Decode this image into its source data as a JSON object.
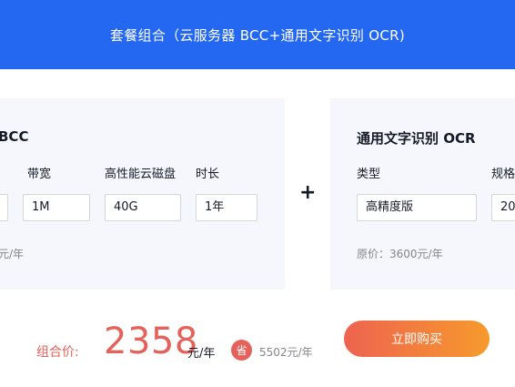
{
  "header": {
    "title": "套餐组合（云服务器 BCC+通用文字识别 OCR)"
  },
  "bcc_card": {
    "title": "BCC",
    "bandwidth_label": "带宽",
    "bandwidth_value": "1M",
    "disk_label": "高性能云磁盘",
    "disk_value": "40G",
    "duration_label": "时长",
    "duration_value": "1年",
    "original_price_partial": "元/年"
  },
  "plus_sign": "+",
  "ocr_card": {
    "title": "通用文字识别 OCR",
    "type_label": "类型",
    "type_value": "高精度版",
    "spec_label": "规格",
    "spec_value": "20",
    "original_price": "原价：3600元/年"
  },
  "footer": {
    "combo_label": "组合价:",
    "combo_price": "2358",
    "combo_unit": "元/年",
    "save_badge": "省",
    "save_amount": "5502元/年",
    "buy_button": "立即购买"
  }
}
